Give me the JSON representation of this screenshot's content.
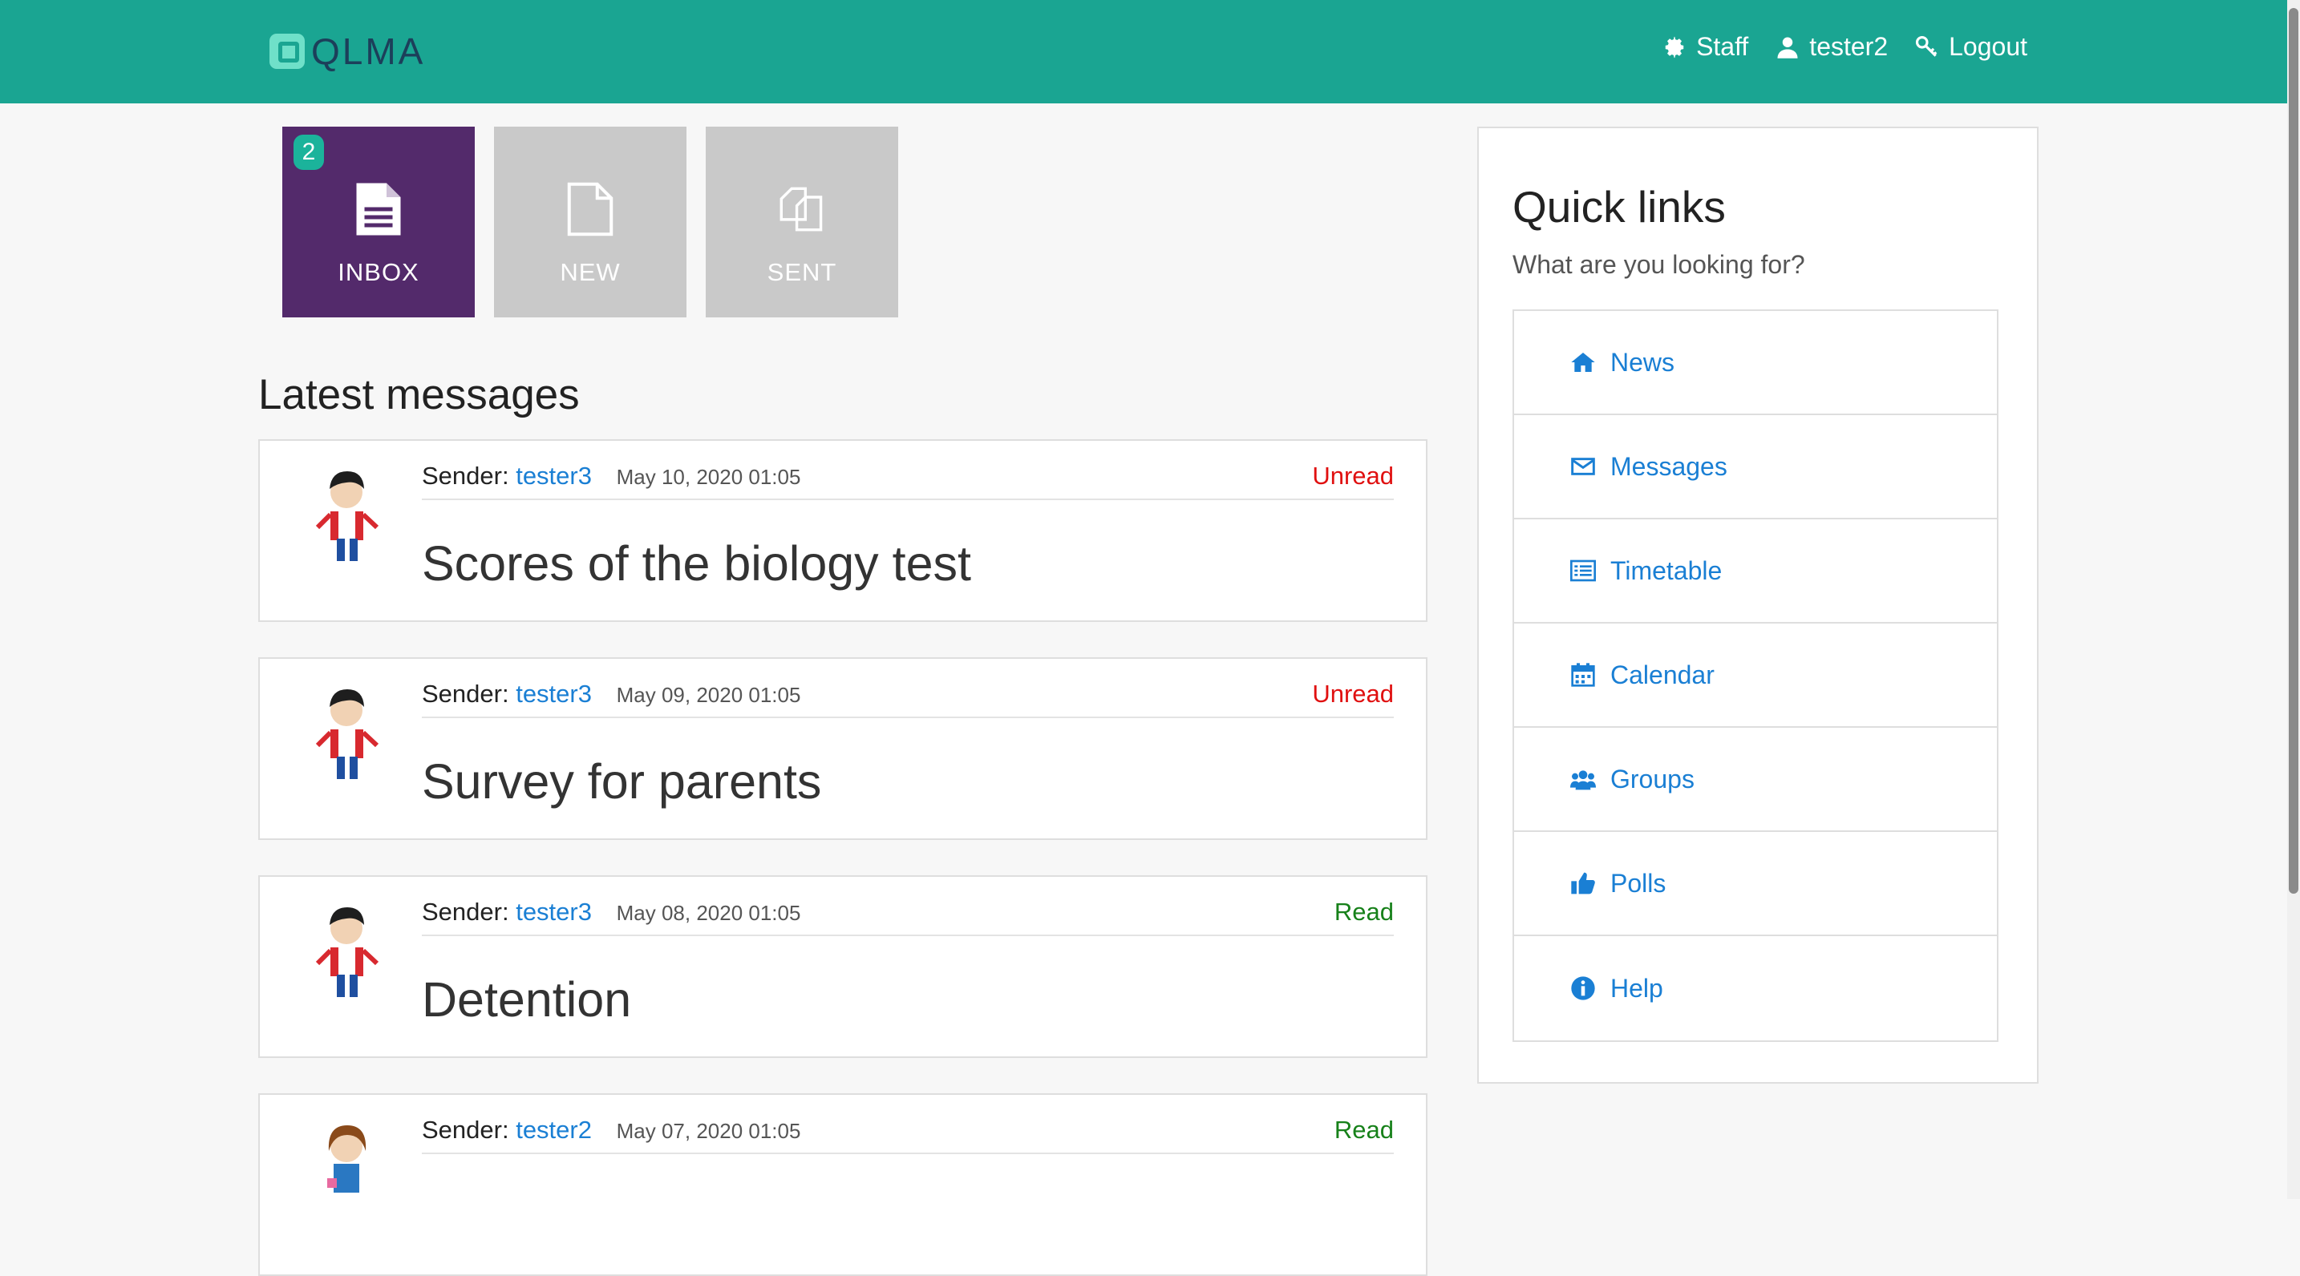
{
  "app": {
    "name": "QLMA"
  },
  "nav": {
    "staff": "Staff",
    "user": "tester2",
    "logout": "Logout"
  },
  "tiles": {
    "inbox": "INBOX",
    "inbox_badge": "2",
    "new": "NEW",
    "sent": "SENT"
  },
  "messages_section": {
    "title": "Latest messages",
    "sender_label": "Sender:",
    "items": [
      {
        "sender": "tester3",
        "date": "May 10, 2020 01:05",
        "status": "Unread",
        "subject": "Scores of the biology test"
      },
      {
        "sender": "tester3",
        "date": "May 09, 2020 01:05",
        "status": "Unread",
        "subject": "Survey for parents"
      },
      {
        "sender": "tester3",
        "date": "May 08, 2020 01:05",
        "status": "Read",
        "subject": "Detention"
      },
      {
        "sender": "tester2",
        "date": "May 07, 2020 01:05",
        "status": "Read",
        "subject": ""
      }
    ]
  },
  "quick_links": {
    "title": "Quick links",
    "subtitle": "What are you looking for?",
    "items": [
      {
        "label": "News",
        "icon": "home-icon"
      },
      {
        "label": "Messages",
        "icon": "envelope-icon"
      },
      {
        "label": "Timetable",
        "icon": "list-icon"
      },
      {
        "label": "Calendar",
        "icon": "calendar-icon"
      },
      {
        "label": "Groups",
        "icon": "users-icon"
      },
      {
        "label": "Polls",
        "icon": "thumbs-up-icon"
      },
      {
        "label": "Help",
        "icon": "info-icon"
      }
    ]
  },
  "colors": {
    "header": "#1aa592",
    "inbox_tile": "#532a6b",
    "link": "#1a7fd4",
    "unread": "#e01010",
    "read": "#17811a"
  }
}
